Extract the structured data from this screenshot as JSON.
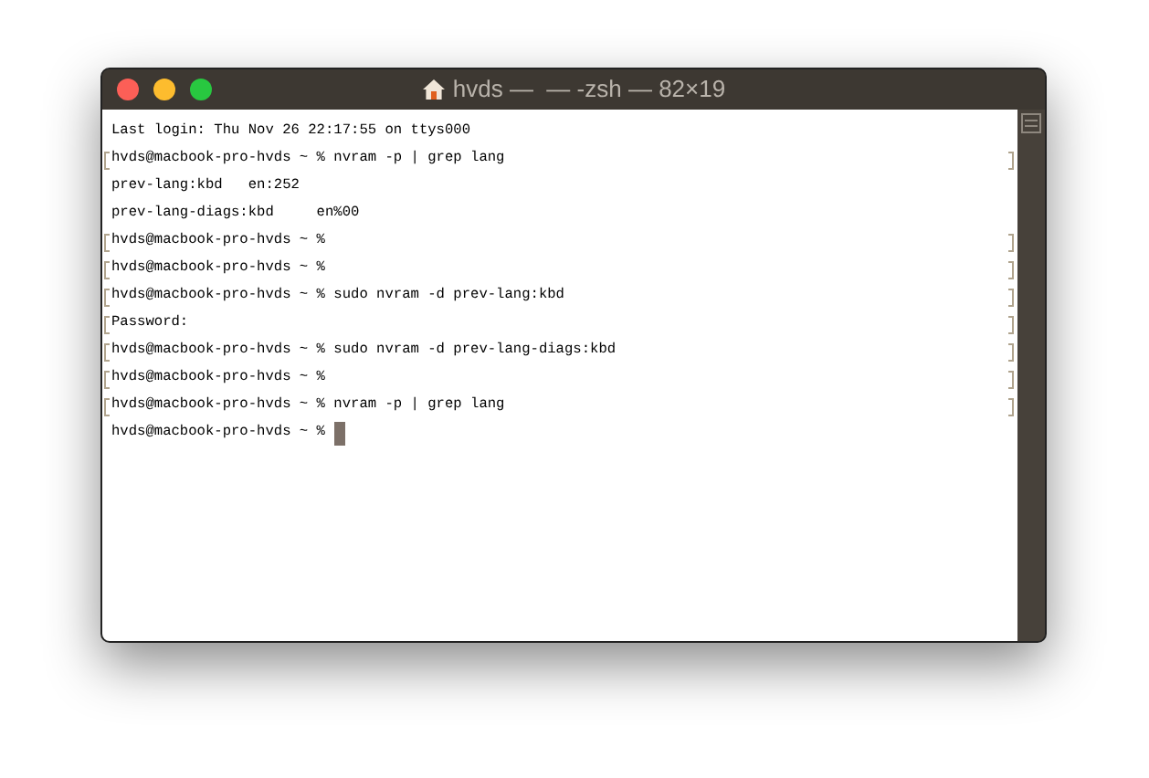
{
  "window": {
    "title": "hvds —  — -zsh — 82×19"
  },
  "lines": [
    {
      "text": "Last login: Thu Nov 26 22:17:55 on ttys000",
      "marked": false,
      "cursor": false
    },
    {
      "text": "hvds@macbook-pro-hvds ~ % nvram -p | grep lang",
      "marked": true,
      "cursor": false
    },
    {
      "text": "prev-lang:kbd   en:252",
      "marked": false,
      "cursor": false
    },
    {
      "text": "prev-lang-diags:kbd     en%00",
      "marked": false,
      "cursor": false
    },
    {
      "text": "hvds@macbook-pro-hvds ~ %",
      "marked": true,
      "cursor": false
    },
    {
      "text": "hvds@macbook-pro-hvds ~ %",
      "marked": true,
      "cursor": false
    },
    {
      "text": "hvds@macbook-pro-hvds ~ % sudo nvram -d prev-lang:kbd",
      "marked": true,
      "cursor": false
    },
    {
      "text": "Password:",
      "marked": true,
      "cursor": false
    },
    {
      "text": "hvds@macbook-pro-hvds ~ % sudo nvram -d prev-lang-diags:kbd",
      "marked": true,
      "cursor": false
    },
    {
      "text": "hvds@macbook-pro-hvds ~ %",
      "marked": true,
      "cursor": false
    },
    {
      "text": "hvds@macbook-pro-hvds ~ % nvram -p | grep lang",
      "marked": true,
      "cursor": false
    },
    {
      "text": "hvds@macbook-pro-hvds ~ %",
      "marked": false,
      "cursor": true
    }
  ]
}
